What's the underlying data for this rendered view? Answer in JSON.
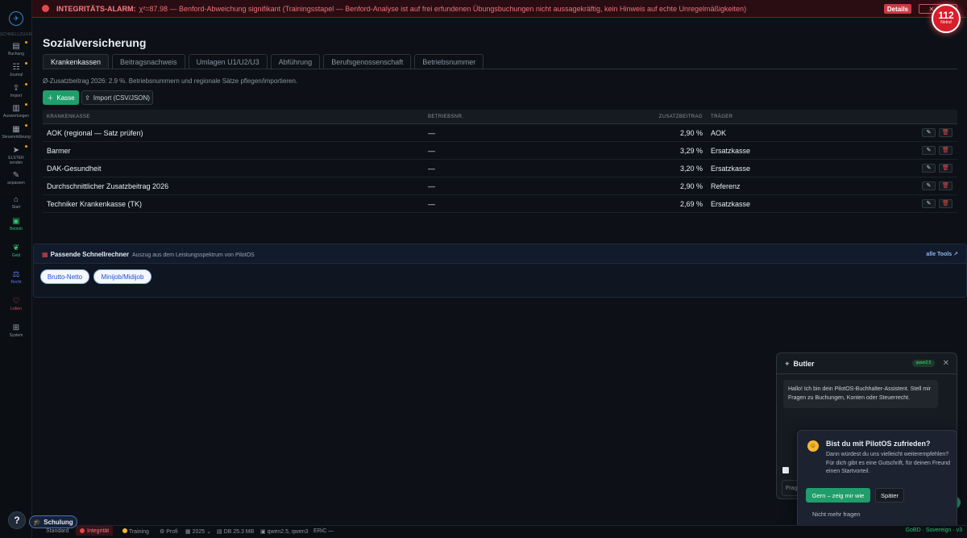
{
  "alarm": {
    "label": "INTEGRITÄTS-ALARM:",
    "message": "χ²=87.98 — Benford-Abweichung signifikant (Trainingsstapel — Benford-Analyse ist auf frei erfundenen Übungsbuchungen nicht aussagekräftig, kein Hinweis auf echte Unregelmäßigkeiten)",
    "details_label": "Details",
    "close_label": "✕ Sch"
  },
  "emergency_badge": {
    "number": "112",
    "label": "Notruf"
  },
  "sidebar": {
    "header": "SCHNELLZUGR.",
    "items": [
      {
        "label": "Buchung",
        "icon": "document-icon"
      },
      {
        "label": "Journal",
        "icon": "journal-icon"
      },
      {
        "label": "Import",
        "icon": "upload-icon"
      },
      {
        "label": "Auswertungen",
        "icon": "chart-icon"
      },
      {
        "label": "Steuererklärung",
        "icon": "tax-icon"
      },
      {
        "label": "ELSTER senden",
        "icon": "send-icon"
      },
      {
        "label": "anpassen",
        "icon": "pencil-icon"
      },
      {
        "label": "Start",
        "icon": "home-icon"
      },
      {
        "label": "Betrieb",
        "icon": "briefcase-icon"
      },
      {
        "label": "Geld",
        "icon": "leaf-icon"
      },
      {
        "label": "Recht",
        "icon": "scale-icon"
      },
      {
        "label": "Leben",
        "icon": "heart-icon"
      },
      {
        "label": "System",
        "icon": "grid-icon"
      }
    ],
    "help_label": "?"
  },
  "page": {
    "title": "Sozialversicherung",
    "tabs": [
      {
        "label": "Krankenkassen"
      },
      {
        "label": "Beitragsnachweis"
      },
      {
        "label": "Umlagen U1/U2/U3"
      },
      {
        "label": "Abführung"
      },
      {
        "label": "Berufsgenossenschaft"
      },
      {
        "label": "Betriebsnummer"
      }
    ],
    "note": "Ø-Zusatzbeitrag 2026: 2.9 %. Betriebsnummern und regionale Sätze pflegen/importieren.",
    "add_label": "Kasse",
    "import_label": "Import (CSV/JSON)"
  },
  "table": {
    "columns": [
      "KRANKENKASSE",
      "BETRIEBSNR.",
      "ZUSATZBEITRAG",
      "TRÄGER"
    ],
    "rows": [
      {
        "name": "AOK (regional — Satz prüfen)",
        "betriebsnr": "—",
        "zusatz": "2,90 %",
        "traeger": "AOK"
      },
      {
        "name": "Barmer",
        "betriebsnr": "—",
        "zusatz": "3,29 %",
        "traeger": "Ersatzkasse"
      },
      {
        "name": "DAK-Gesundheit",
        "betriebsnr": "—",
        "zusatz": "3,20 %",
        "traeger": "Ersatzkasse"
      },
      {
        "name": "Durchschnittlicher Zusatzbeitrag 2026",
        "betriebsnr": "—",
        "zusatz": "2,90 %",
        "traeger": "Referenz"
      },
      {
        "name": "Techniker Krankenkasse (TK)",
        "betriebsnr": "—",
        "zusatz": "2,69 %",
        "traeger": "Ersatzkasse"
      }
    ]
  },
  "schnellrechner": {
    "title": "Passende Schnellrechner",
    "subtitle": "Auszug aus dem Leistungsspektrum von PilotOS",
    "all_tools": "alle Tools ↗",
    "tools": [
      "Brutto-Netto",
      "Minijob/Midijob"
    ]
  },
  "butler": {
    "title": "Butler",
    "model_tag": "qwen2.5",
    "greeting": "Hallo! Ich bin dein PilotOS-Buchhalter-Assistent. Stell mir Fragen zu Buchungen, Konten oder Steuerrecht.",
    "input_placeholder": "Frag"
  },
  "survey": {
    "question": "Bist du mit PilotOS zufrieden?",
    "text": "Dann würdest du uns vielleicht weiterempfehlen? Für dich gibt es eine Gutschrift, für deinen Freund einen Startvorteil.",
    "yes_label": "Gern – zeig mir wie",
    "later_label": "Später",
    "never_label": "Nicht mehr fragen"
  },
  "statusbar": {
    "schulung": "Schulung",
    "standard": "Standard",
    "integritaet": "Integrität",
    "training": "Training",
    "profi": "Profi",
    "year": "2025",
    "db": "DB 25.3 MB",
    "models": "qwen2.5, qwen3",
    "eric": "ERiC —",
    "sovereign": "GoBD · Sovereign · v3"
  },
  "colors": {
    "accent_green": "#1f9d6a",
    "alarm_red": "#e5484d",
    "link_blue": "#93b4e8"
  }
}
